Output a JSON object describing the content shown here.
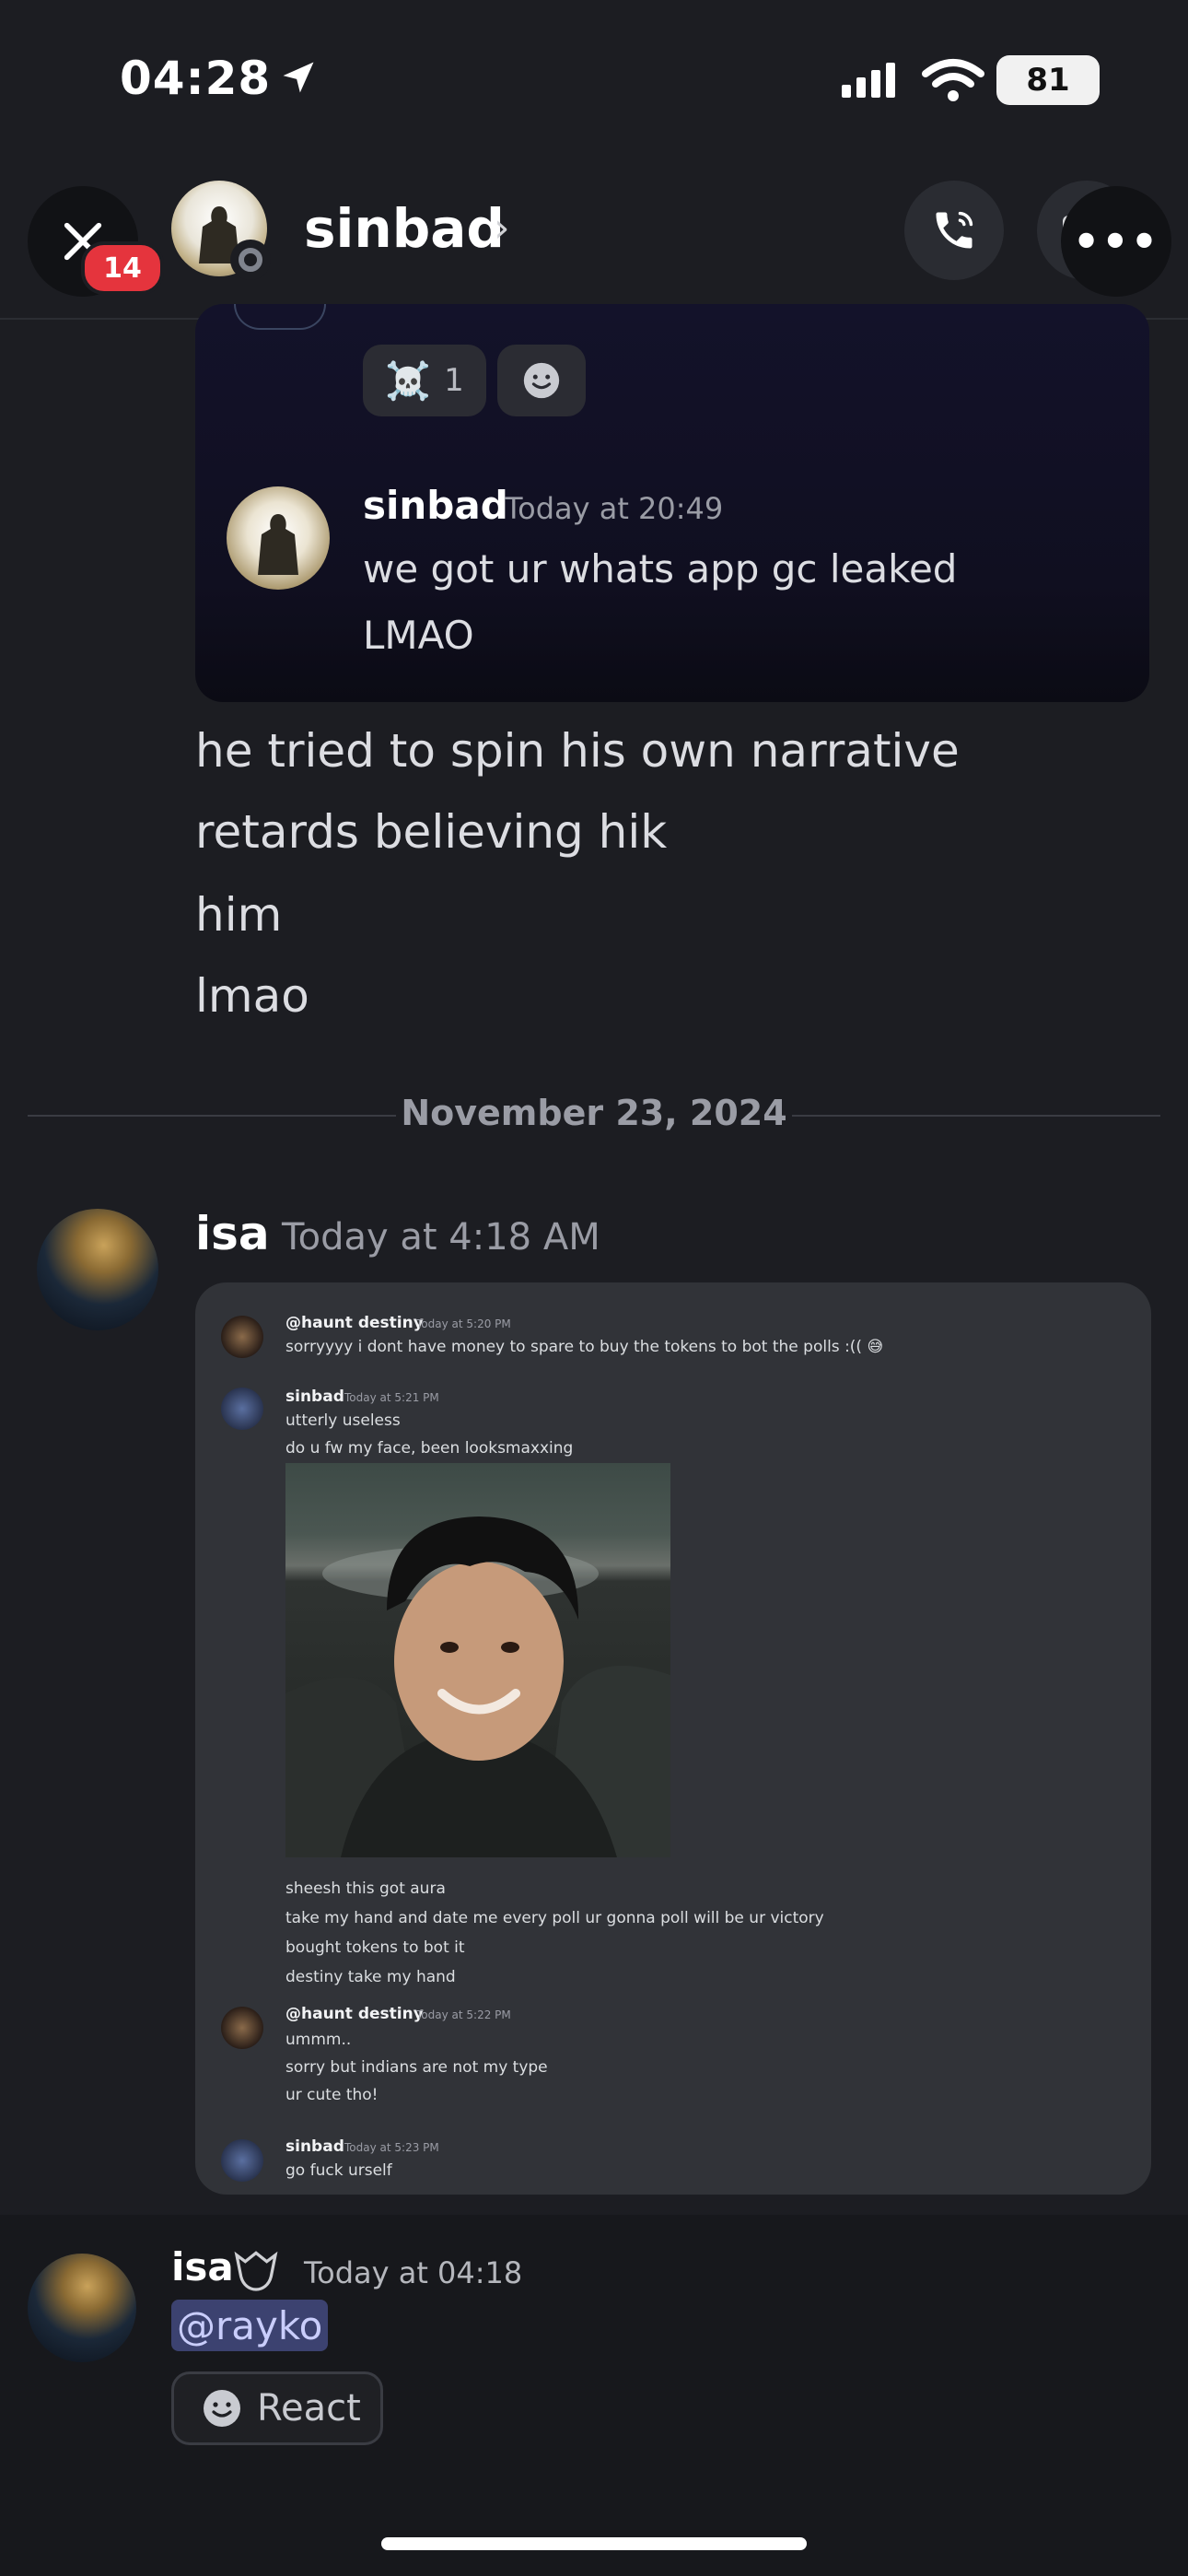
{
  "status_bar": {
    "time": "04:28",
    "battery": "81"
  },
  "header": {
    "unread_badge": "14",
    "contact_name": "sinbad",
    "chevron": "›",
    "more": "•••"
  },
  "quoted_embed": {
    "reactions": [
      {
        "emoji": "☠️",
        "count": "1"
      },
      {
        "emoji": "🙂",
        "count": ""
      }
    ],
    "author": "sinbad",
    "time": "Today at 20:49",
    "lines": [
      "we got ur whats app gc leaked",
      "LMAO"
    ]
  },
  "messages": [
    "he tried to spin his own narrative",
    "retards believing hik",
    "him",
    "lmao"
  ],
  "date_divider": "November 23, 2024",
  "isa_message": {
    "author": "isa",
    "time": "Today at 4:18 AM"
  },
  "screenshot": {
    "m1": {
      "author": "@haunt destiny",
      "time": "Today at 5:20 PM",
      "lines": [
        "sorryyyy i dont have money to spare to buy the tokens to bot the polls :(( 😅"
      ]
    },
    "m2": {
      "author": "sinbad",
      "time": "Today at 5:21 PM",
      "lines": [
        "utterly useless",
        "do u fw my face, been looksmaxxing"
      ],
      "after_image": [
        "sheesh this got aura",
        "take my hand and date me every poll ur gonna poll will be ur victory",
        "bought tokens to bot it",
        "destiny take my hand"
      ]
    },
    "m3": {
      "author": "@haunt destiny",
      "time": "Today at 5:22 PM",
      "lines": [
        "ummm..",
        "sorry but indians are not my type",
        "ur cute tho!"
      ]
    },
    "m4": {
      "author": "sinbad",
      "time": "Today at 5:23 PM",
      "lines": [
        "go fuck urself"
      ]
    }
  },
  "bottom_message": {
    "author": "isa",
    "time": "Today at 04:18",
    "mention": "@rayko",
    "react_label": "React"
  }
}
